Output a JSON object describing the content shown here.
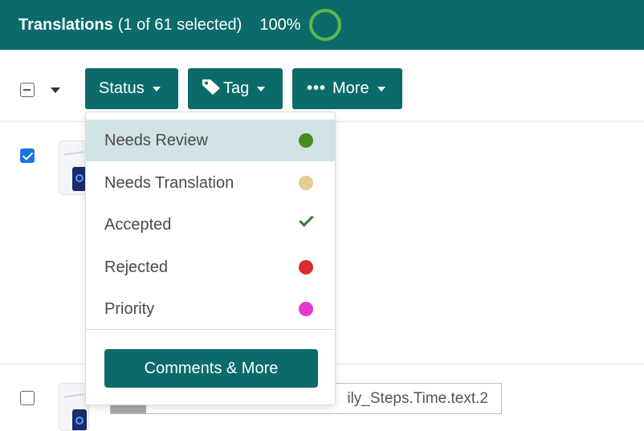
{
  "header": {
    "title": "Translations",
    "selection": "(1 of 61 selected)",
    "progress": "100%",
    "progress_value": 1.0,
    "progress_color": "#5fb84a",
    "background": "#0b6b6a"
  },
  "toolbar": {
    "status_label": "Status",
    "tag_label": "Tag",
    "more_label": "More",
    "tag_icon": "tag-icon",
    "more_icon": "ellipsis-icon"
  },
  "status_menu": {
    "items": [
      {
        "label": "Needs Review",
        "marker": "dot",
        "color": "#4a8a1d",
        "active": true
      },
      {
        "label": "Needs Translation",
        "marker": "dot",
        "color": "#e3cf92",
        "active": false
      },
      {
        "label": "Accepted",
        "marker": "check-icon",
        "color": "#2e7d32",
        "active": false
      },
      {
        "label": "Rejected",
        "marker": "dot",
        "color": "#d92b2b",
        "active": false
      },
      {
        "label": "Priority",
        "marker": "dot",
        "color": "#e23ad0",
        "active": false
      }
    ],
    "comments_button": "Comments & More"
  },
  "rows": [
    {
      "checked": true
    },
    {
      "checked": false,
      "key_text": "ily_Steps.Time.text.2"
    }
  ]
}
